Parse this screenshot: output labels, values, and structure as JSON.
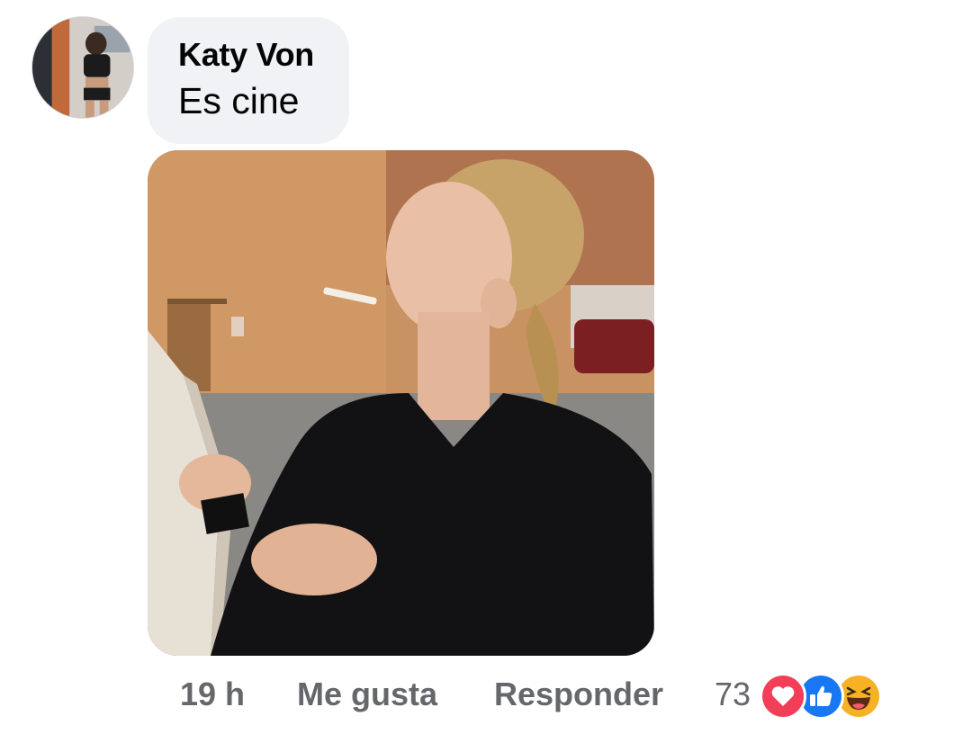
{
  "comment": {
    "author": "Katy Von",
    "text": "Es cine"
  },
  "footer": {
    "timestamp": "19 h",
    "like_label": "Me gusta",
    "reply_label": "Responder",
    "reaction_count": "73",
    "reactions": [
      "love-icon",
      "like-icon",
      "haha-icon"
    ]
  },
  "colors": {
    "bubble_bg": "#f0f2f5",
    "secondary_text": "#65676b",
    "love": "#f33e58",
    "like": "#1877f2",
    "haha": "#f7b125"
  }
}
